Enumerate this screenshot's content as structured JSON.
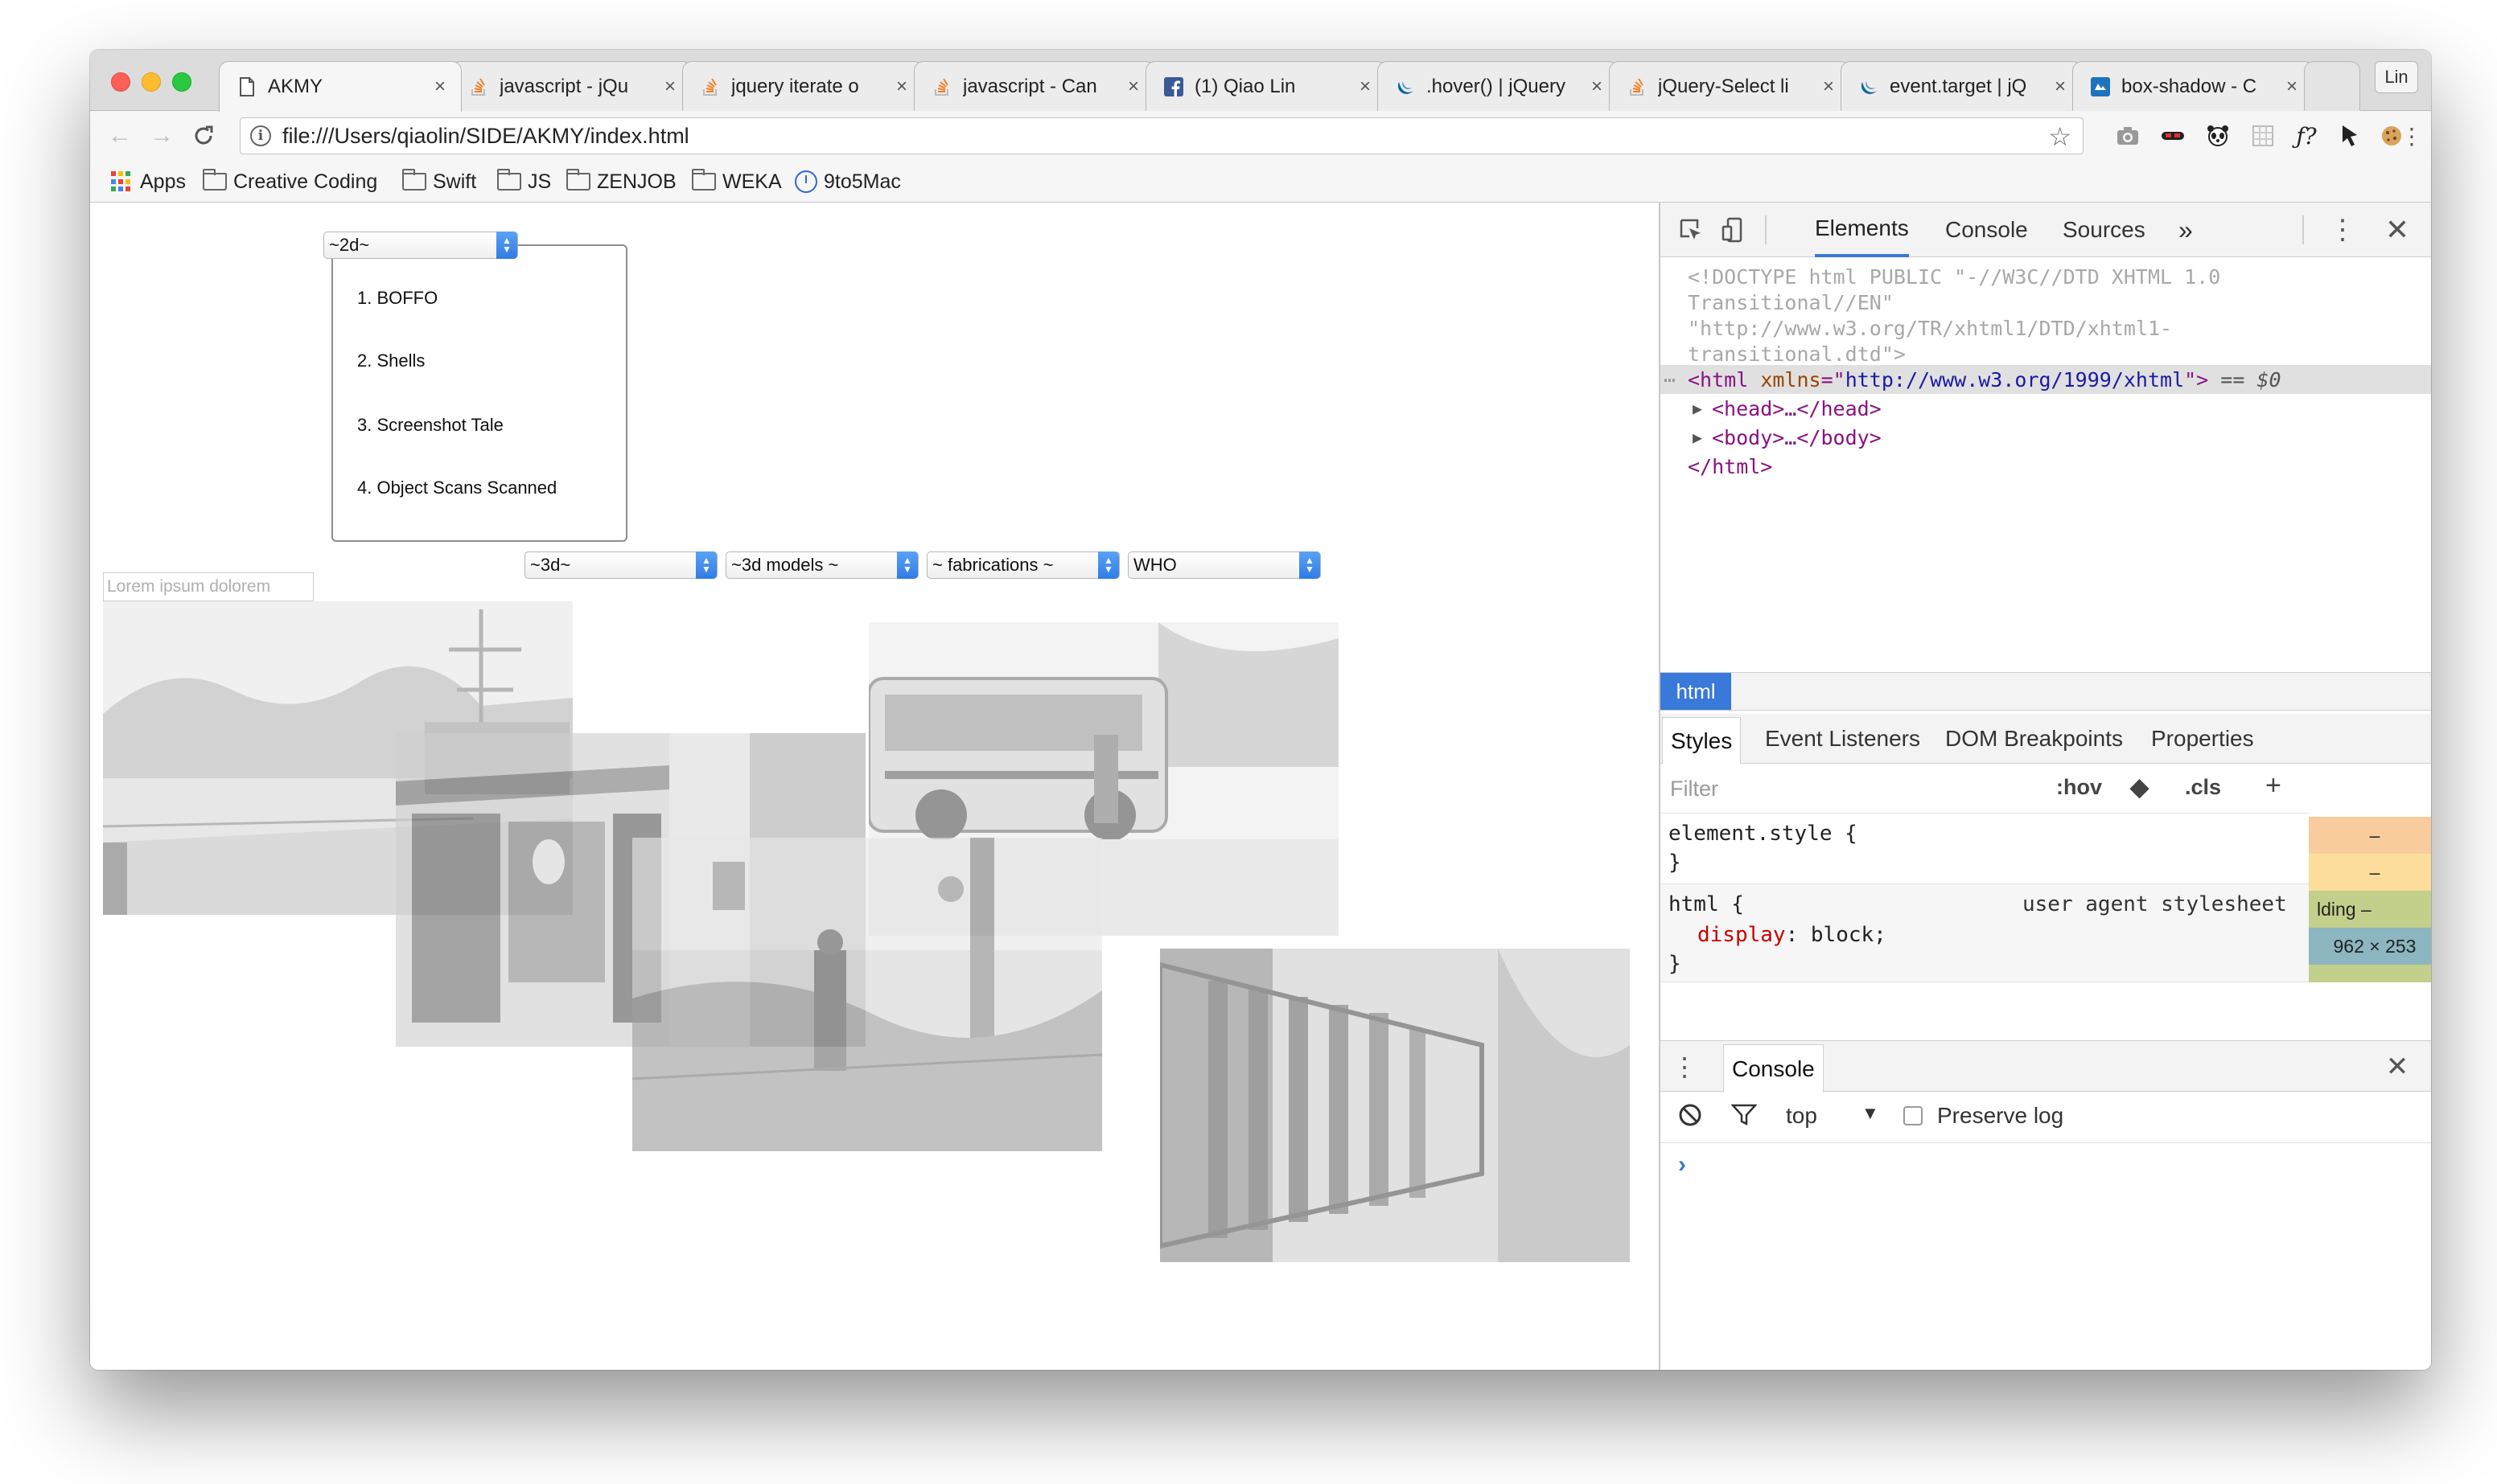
{
  "browser": {
    "tabs": [
      {
        "title": "AKMY",
        "icon": "page-icon"
      },
      {
        "title": "javascript - jQu",
        "icon": "stackoverflow-icon"
      },
      {
        "title": "jquery iterate o",
        "icon": "stackoverflow-icon"
      },
      {
        "title": "javascript - Can",
        "icon": "stackoverflow-icon"
      },
      {
        "title": "(1) Qiao Lin",
        "icon": "facebook-icon"
      },
      {
        "title": ".hover() | jQuery",
        "icon": "jquery-icon"
      },
      {
        "title": "jQuery-Select li",
        "icon": "stackoverflow-icon"
      },
      {
        "title": "event.target | jQ",
        "icon": "jquery-icon"
      },
      {
        "title": "box-shadow - C",
        "icon": "css-tricks-icon"
      }
    ],
    "profile_label": "Lin",
    "url": "file:///Users/qiaolin/SIDE/AKMY/index.html",
    "bookmarks": [
      "Apps",
      "Creative Coding",
      "Swift",
      "JS",
      "ZENJOB",
      "WEKA",
      "9to5Mac"
    ]
  },
  "page": {
    "select_2d": "~2d~",
    "list_items": [
      "1. BOFFO",
      "2. Shells",
      "3. Screenshot Tale",
      "4. Object Scans Scanned"
    ],
    "selects": [
      "~3d~",
      "~3d models ~",
      "~ fabrications ~",
      "WHO"
    ],
    "search_placeholder": "Lorem ipsum dolorem"
  },
  "devtools": {
    "tabs": [
      "Elements",
      "Console",
      "Sources"
    ],
    "more": "»",
    "dom": {
      "doctype_1": "<!DOCTYPE html PUBLIC \"-//W3C//DTD XHTML 1.0",
      "doctype_2": "Transitional//EN\"",
      "doctype_3": "\"http://www.w3.org/TR/xhtml1/DTD/xhtml1-",
      "doctype_4": "transitional.dtd\">",
      "html_open_tag": "<html ",
      "html_attr": "xmlns",
      "html_eq": "=\"",
      "html_attr_val": "http://www.w3.org/1999/xhtml",
      "html_close": "\">",
      "selected_marker": " == $0",
      "head": "<head>…</head>",
      "body": "<body>…</body>",
      "html_end": "</html>"
    },
    "breadcrumb": "html",
    "subtabs": [
      "Styles",
      "Event Listeners",
      "DOM Breakpoints",
      "Properties"
    ],
    "filter_placeholder": "Filter",
    "hov": ":hov",
    "cls": ".cls",
    "plus": "+",
    "element_style_open": "element.style {",
    "element_style_close": "}",
    "html_rule_selector": "html {",
    "html_rule_source": "user agent stylesheet",
    "html_rule_prop": "display",
    "html_rule_value": "block;",
    "html_rule_close": "}",
    "box_model": [
      "–",
      "–",
      "lding –",
      "962 × 253"
    ],
    "console_tab": "Console",
    "console_context": "top",
    "preserve_log": "Preserve log",
    "prompt": "›"
  },
  "colors": {
    "accent": "#3879d9",
    "box_margin": "#f9cc9d",
    "box_border": "#fddd9b",
    "box_padding": "#c3d08b",
    "box_content": "#8cb6c0"
  }
}
